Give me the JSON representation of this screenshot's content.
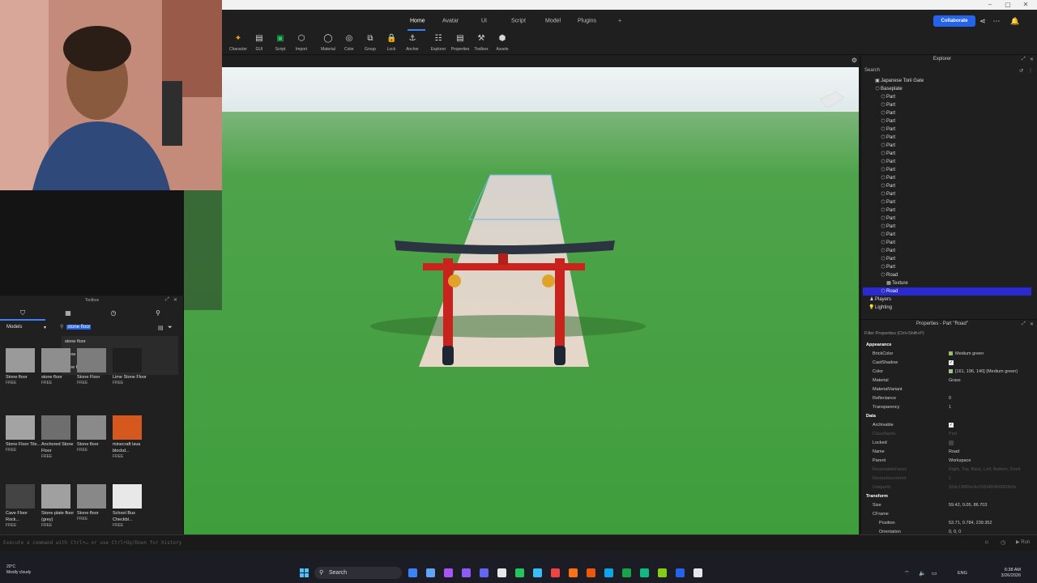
{
  "tabs": [
    "Home",
    "Avatar",
    "UI",
    "Script",
    "Model",
    "Plugins",
    "+"
  ],
  "collaborate_label": "Collaborate",
  "ribbon": [
    "Character",
    "GUI",
    "Script",
    "Import",
    "Material",
    "Color",
    "Group",
    "Lock",
    "Anchor",
    "Explorer",
    "Properties",
    "Toolbox",
    "Assets"
  ],
  "toolbox": {
    "title": "Toolbox",
    "category": "Models",
    "search_value": "stone floor",
    "suggestions": [
      "stone floor",
      "stone flor",
      "store floor"
    ],
    "items": [
      {
        "name": "Stone floor",
        "price": "FREE",
        "color": "#9a9a9a"
      },
      {
        "name": "stone floor",
        "price": "FREE",
        "color": "#8e8e8e"
      },
      {
        "name": "Stone Floor",
        "price": "FREE",
        "color": "#7c7c7c"
      },
      {
        "name": "Lime Stone Floor",
        "price": "FREE",
        "color": "#1f1f1f"
      },
      {
        "name": "Stone Floor Tile...",
        "price": "FREE",
        "color": "#a3a3a3"
      },
      {
        "name": "Anchored Stone Floor",
        "price": "FREE",
        "color": "#6e6e6e"
      },
      {
        "name": "Stone floor",
        "price": "FREE",
        "color": "#8a8a8a"
      },
      {
        "name": "minecraft lava blockd...",
        "price": "FREE",
        "color": "#d5581f"
      },
      {
        "name": "Cave Floor Rock...",
        "price": "FREE",
        "color": "#444444"
      },
      {
        "name": "Stone plate floor (grey)",
        "price": "FREE",
        "color": "#a0a0a0"
      },
      {
        "name": "Stone floor",
        "price": "FREE",
        "color": "#888888"
      },
      {
        "name": "School Bus Checkbl...",
        "price": "FREE",
        "color": "#e8e8e8"
      }
    ]
  },
  "explorer": {
    "title": "Explorer",
    "search_placeholder": "Search",
    "rows": [
      {
        "label": "Japanese Torii Gate",
        "indent": 2,
        "icon": "▣"
      },
      {
        "label": "Baseplate",
        "indent": 2,
        "icon": "⬡"
      },
      {
        "label": "Part",
        "indent": 3,
        "icon": "⬡"
      },
      {
        "label": "Part",
        "indent": 3,
        "icon": "⬡"
      },
      {
        "label": "Part",
        "indent": 3,
        "icon": "⬡"
      },
      {
        "label": "Part",
        "indent": 3,
        "icon": "⬡"
      },
      {
        "label": "Part",
        "indent": 3,
        "icon": "⬡"
      },
      {
        "label": "Part",
        "indent": 3,
        "icon": "⬡"
      },
      {
        "label": "Part",
        "indent": 3,
        "icon": "⬡"
      },
      {
        "label": "Part",
        "indent": 3,
        "icon": "⬡"
      },
      {
        "label": "Part",
        "indent": 3,
        "icon": "⬡"
      },
      {
        "label": "Part",
        "indent": 3,
        "icon": "⬡"
      },
      {
        "label": "Part",
        "indent": 3,
        "icon": "⬡"
      },
      {
        "label": "Part",
        "indent": 3,
        "icon": "⬡"
      },
      {
        "label": "Part",
        "indent": 3,
        "icon": "⬡"
      },
      {
        "label": "Part",
        "indent": 3,
        "icon": "⬡"
      },
      {
        "label": "Part",
        "indent": 3,
        "icon": "⬡"
      },
      {
        "label": "Part",
        "indent": 3,
        "icon": "⬡"
      },
      {
        "label": "Part",
        "indent": 3,
        "icon": "⬡"
      },
      {
        "label": "Part",
        "indent": 3,
        "icon": "⬡"
      },
      {
        "label": "Part",
        "indent": 3,
        "icon": "⬡"
      },
      {
        "label": "Part",
        "indent": 3,
        "icon": "⬡"
      },
      {
        "label": "Part",
        "indent": 3,
        "icon": "⬡"
      },
      {
        "label": "Part",
        "indent": 3,
        "icon": "⬡"
      },
      {
        "label": "Road",
        "indent": 3,
        "icon": "⬡"
      },
      {
        "label": "Texture",
        "indent": 4,
        "icon": "▦"
      },
      {
        "label": "Road",
        "indent": 3,
        "icon": "⬡",
        "selected": true
      },
      {
        "label": "Players",
        "indent": 1,
        "icon": "♟"
      },
      {
        "label": "Lighting",
        "indent": 1,
        "icon": "💡"
      }
    ]
  },
  "properties": {
    "title": "Properties - Part \"Road\"",
    "filter_placeholder": "Filter Properties (Ctrl+Shift+P)",
    "rows": [
      {
        "type": "section",
        "label": "Appearance"
      },
      {
        "type": "prop",
        "name": "BrickColor",
        "value": "Medium green",
        "swatch": "#8fbf6a"
      },
      {
        "type": "prop",
        "name": "CastShadow",
        "value": "",
        "check": true
      },
      {
        "type": "prop",
        "name": "Color",
        "value": "[161, 196, 140] (Medium green)",
        "swatch": "#a1c48c"
      },
      {
        "type": "prop",
        "name": "Material",
        "value": "Grass"
      },
      {
        "type": "prop",
        "name": "MaterialVariant",
        "value": ""
      },
      {
        "type": "prop",
        "name": "Reflectance",
        "value": "0"
      },
      {
        "type": "prop",
        "name": "Transparency",
        "value": "1"
      },
      {
        "type": "section",
        "label": "Data"
      },
      {
        "type": "prop",
        "name": "Archivable",
        "value": "",
        "check": true
      },
      {
        "type": "prop",
        "name": "ClassName",
        "value": "Part",
        "dim": true
      },
      {
        "type": "prop",
        "name": "Locked",
        "value": "",
        "dim_check": true
      },
      {
        "type": "prop",
        "name": "Name",
        "value": "Road"
      },
      {
        "type": "prop",
        "name": "Parent",
        "value": "Workspace"
      },
      {
        "type": "prop",
        "name": "ResizeableFaces",
        "value": "Right, Top, Back, Left, Bottom, Front",
        "dim": true
      },
      {
        "type": "prop",
        "name": "ResizeIncrement",
        "value": "1",
        "dim": true
      },
      {
        "type": "prop",
        "name": "UniqueId",
        "value": "32dc13f80ecfe10004f2400000b2e",
        "dim": true
      },
      {
        "type": "section",
        "label": "Transform"
      },
      {
        "type": "prop",
        "name": "Size",
        "value": "59.42, 0.05, 86.703"
      },
      {
        "type": "prop",
        "name": "CFrame",
        "value": ""
      },
      {
        "type": "prop",
        "name": "Position",
        "value": "53.71, 0.784, 239.352",
        "indent": true
      },
      {
        "type": "prop",
        "name": "Orientation",
        "value": "0, 0, 0",
        "indent": true
      }
    ]
  },
  "command_placeholder": "Execute a command with Ctrl+↵ or use Ctrl+Up/Down for history",
  "taskbar": {
    "weather_temp": "20°C",
    "weather_desc": "Mostly cloudy",
    "search_label": "Search",
    "lang": "ENG",
    "time": "6:38 AM",
    "date": "3/26/2026",
    "apps": [
      "#3b82f6",
      "#60a5fa",
      "#a855f7",
      "#8b5cf6",
      "#6366f1",
      "#e5e7eb",
      "#22c55e",
      "#38bdf8",
      "#ef4444",
      "#f97316",
      "#ea580c",
      "#0ea5e9",
      "#16a34a",
      "#10b981",
      "#84cc16",
      "#2563eb",
      "#e5e7eb"
    ]
  },
  "colors": {
    "accent": "#3b82f6",
    "selection": "#2a2ad0",
    "torii_red": "#c8231d"
  }
}
